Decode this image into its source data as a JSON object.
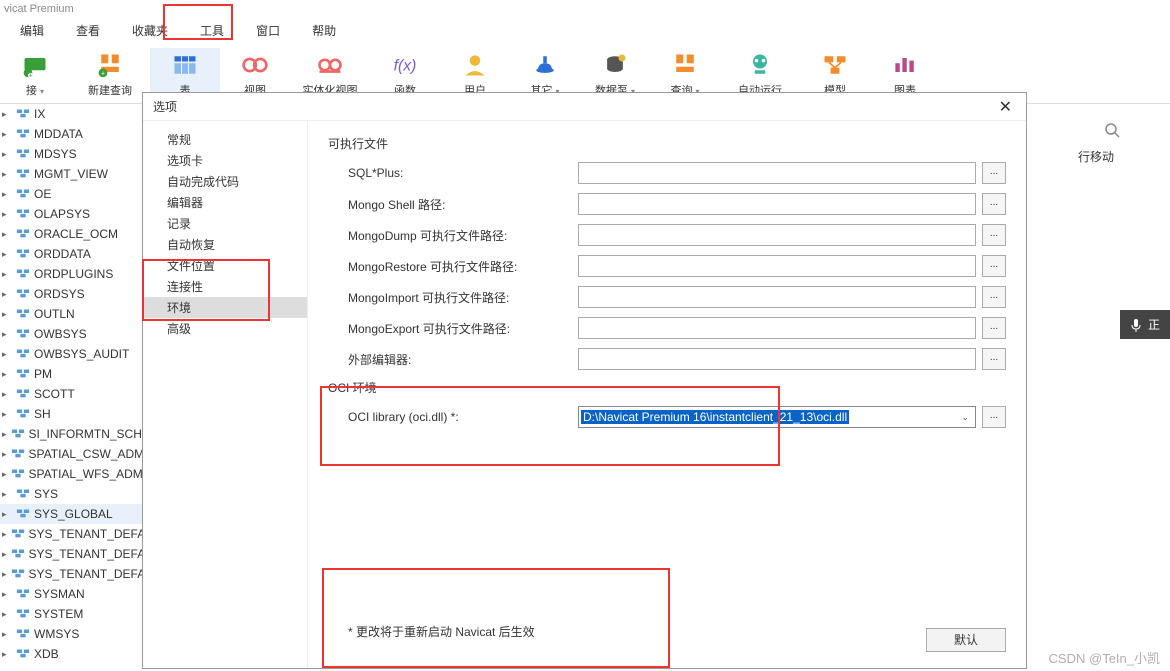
{
  "app_title": "vicat Premium",
  "menu": [
    "编辑",
    "查看",
    "收藏夹",
    "工具",
    "窗口",
    "帮助"
  ],
  "toolbar": [
    {
      "key": "connect",
      "label": "接"
    },
    {
      "key": "newquery",
      "label": "新建查询"
    },
    {
      "key": "table",
      "label": "表"
    },
    {
      "key": "view",
      "label": "视图"
    },
    {
      "key": "matview",
      "label": "实体化视图"
    },
    {
      "key": "function",
      "label": "函数"
    },
    {
      "key": "user",
      "label": "用户"
    },
    {
      "key": "other",
      "label": "其它"
    },
    {
      "key": "pump",
      "label": "数据泵"
    },
    {
      "key": "query",
      "label": "查询"
    },
    {
      "key": "autorun",
      "label": "自动运行"
    },
    {
      "key": "model",
      "label": "模型"
    },
    {
      "key": "chart",
      "label": "图表"
    }
  ],
  "tree": [
    "IX",
    "MDDATA",
    "MDSYS",
    "MGMT_VIEW",
    "OE",
    "OLAPSYS",
    "ORACLE_OCM",
    "ORDDATA",
    "ORDPLUGINS",
    "ORDSYS",
    "OUTLN",
    "OWBSYS",
    "OWBSYS_AUDIT",
    "PM",
    "SCOTT",
    "SH",
    "SI_INFORMTN_SCHEMA",
    "SPATIAL_CSW_ADMIN_USR",
    "SPATIAL_WFS_ADMIN_USR",
    "SYS",
    "SYS_GLOBAL",
    "SYS_TENANT_DEFAULT",
    "SYS_TENANT_DEFAULT",
    "SYS_TENANT_DEFAULT",
    "SYSMAN",
    "SYSTEM",
    "WMSYS",
    "XDB"
  ],
  "tree_selected": 20,
  "right": {
    "row_move": "行移动",
    "mic_label": "正"
  },
  "dialog": {
    "title": "选项",
    "close": "✕",
    "nav": [
      "常规",
      "选项卡",
      "自动完成代码",
      "编辑器",
      "记录",
      "自动恢复",
      "文件位置",
      "连接性",
      "环境",
      "高级"
    ],
    "nav_selected": 8,
    "exec_section": "可执行文件",
    "fields": [
      {
        "label": "SQL*Plus:",
        "val": ""
      },
      {
        "label": "Mongo Shell 路径:",
        "val": ""
      },
      {
        "label": "MongoDump 可执行文件路径:",
        "val": ""
      },
      {
        "label": "MongoRestore 可执行文件路径:",
        "val": ""
      },
      {
        "label": "MongoImport 可执行文件路径:",
        "val": ""
      },
      {
        "label": "MongoExport 可执行文件路径:",
        "val": ""
      },
      {
        "label": "外部编辑器:",
        "val": ""
      }
    ],
    "oci_section": "OCI 环境",
    "oci_label": "OCI library (oci.dll) *:",
    "oci_value": "D:\\Navicat Premium 16\\instantclient_21_13\\oci.dll",
    "browse": "...",
    "note": "* 更改将于重新启动 Navicat 后生效",
    "default_btn": "默认"
  },
  "watermark": "CSDN @TeIn_小凯"
}
